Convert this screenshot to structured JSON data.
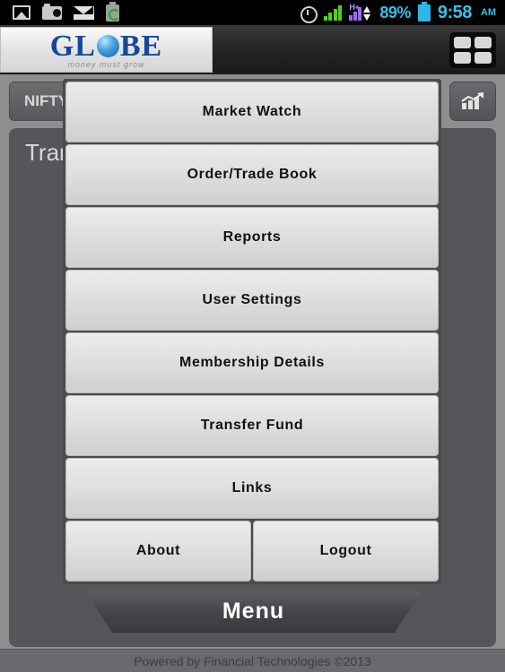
{
  "statusbar": {
    "icons_left": [
      "gallery-icon",
      "camera-icon",
      "mail-icon",
      "battery-saver-icon"
    ],
    "alarm_icon": "alarm-clock-icon",
    "signal_icon": "signal-bars-icon",
    "data_label": "H+",
    "data_icon": "hplus-data-icon",
    "battery_percent": "89%",
    "battery_icon": "battery-icon",
    "time": "9:58",
    "ampm": "AM"
  },
  "header": {
    "logo_text_1": "GL",
    "logo_text_2": "BE",
    "logo_tagline": "money must grow",
    "grid_button": "grid-menu-button"
  },
  "toolbar": {
    "scrip_name": "NIFTY",
    "chart_button": "chart-icon"
  },
  "page": {
    "title": "Tran",
    "footer": "Powered by Financial Technologies ©2013"
  },
  "menu": {
    "tab_label": "Menu",
    "items": [
      {
        "label": "Market Watch",
        "full_width": true
      },
      {
        "label": "Order/Trade Book",
        "full_width": true
      },
      {
        "label": "Reports",
        "full_width": true
      },
      {
        "label": "User Settings",
        "full_width": true
      },
      {
        "label": "Membership Details",
        "full_width": true
      },
      {
        "label": "Transfer Fund",
        "full_width": true
      },
      {
        "label": "Links",
        "full_width": true
      },
      {
        "label": "About",
        "full_width": false
      },
      {
        "label": "Logout",
        "full_width": false
      }
    ]
  },
  "colors": {
    "brand_blue": "#15489b",
    "status_cyan": "#39c0e8",
    "signal_green": "#4fd11a",
    "data_purple": "#9a6bf0",
    "panel_gray": "#56565a",
    "button_light": "#ececec"
  }
}
